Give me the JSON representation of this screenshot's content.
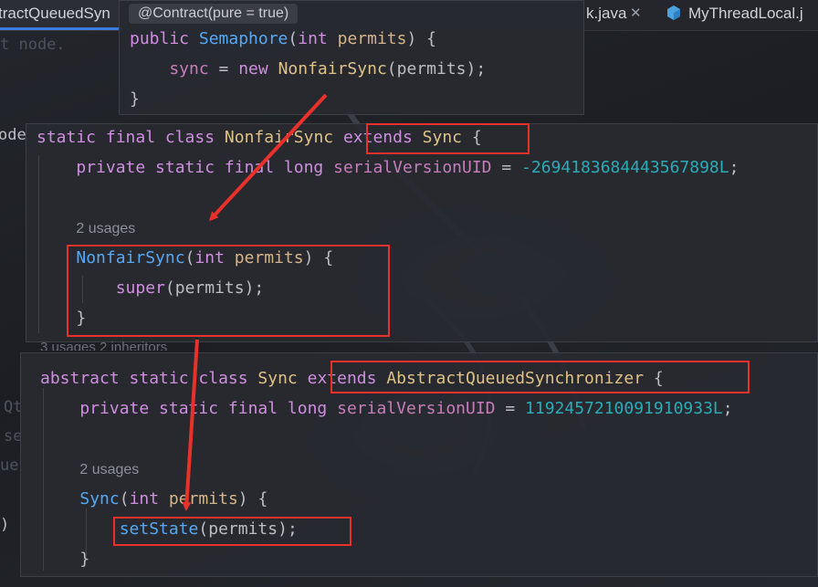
{
  "tabs": [
    {
      "label": "tractQueuedSyn",
      "active": true
    },
    {
      "label": "k.java",
      "active": false
    },
    {
      "label": "MyThreadLocal.j",
      "active": false
    }
  ],
  "background_fragments": {
    "comment": "t node.",
    "gutter_node": "ode",
    "left1": "Qt",
    "left2": "se",
    "left3": "ue",
    "left4": ")",
    "occluded": "3 usages   2 inheritors"
  },
  "popup": {
    "annotation": "@Contract(pure = true)",
    "lines": [
      [
        {
          "t": "public ",
          "c": "kw"
        },
        {
          "t": "Semaphore",
          "c": "fn"
        },
        {
          "t": "(",
          "c": ""
        },
        {
          "t": "int ",
          "c": "kw"
        },
        {
          "t": "permits",
          "c": "param"
        },
        {
          "t": ") {",
          "c": ""
        }
      ],
      [
        {
          "t": "    sync",
          "c": "field"
        },
        {
          "t": " = ",
          "c": ""
        },
        {
          "t": "new ",
          "c": "kw"
        },
        {
          "t": "NonfairSync",
          "c": "cls"
        },
        {
          "t": "(permits);",
          "c": ""
        }
      ],
      [
        {
          "t": "}",
          "c": ""
        }
      ]
    ]
  },
  "nonfair": {
    "lines": [
      [
        {
          "t": "static final class ",
          "c": "kw"
        },
        {
          "t": "NonfairSync ",
          "c": "cls"
        },
        {
          "t": "extends ",
          "c": "kw"
        },
        {
          "t": "Sync",
          "c": "cls"
        },
        {
          "t": " {",
          "c": ""
        }
      ],
      [
        {
          "t": "    private static final long ",
          "c": "kw"
        },
        {
          "t": "serialVersionUID",
          "c": "field"
        },
        {
          "t": " = ",
          "c": ""
        },
        {
          "t": "-2694183684443567898L",
          "c": "num"
        },
        {
          "t": ";",
          "c": ""
        }
      ],
      [
        {
          "t": "",
          "c": ""
        }
      ],
      [
        {
          "t": "    ",
          "c": ""
        },
        {
          "t": "2 usages",
          "c": "hint"
        }
      ],
      [
        {
          "t": "    ",
          "c": ""
        },
        {
          "t": "NonfairSync",
          "c": "fn"
        },
        {
          "t": "(",
          "c": ""
        },
        {
          "t": "int ",
          "c": "kw"
        },
        {
          "t": "permits",
          "c": "param"
        },
        {
          "t": ") {",
          "c": ""
        }
      ],
      [
        {
          "t": "        ",
          "c": ""
        },
        {
          "t": "super",
          "c": "kw"
        },
        {
          "t": "(permits);",
          "c": ""
        }
      ],
      [
        {
          "t": "    }",
          "c": ""
        }
      ]
    ]
  },
  "sync": {
    "lines": [
      [
        {
          "t": "abstract static class ",
          "c": "kw"
        },
        {
          "t": "Sync ",
          "c": "cls"
        },
        {
          "t": "extends ",
          "c": "kw"
        },
        {
          "t": "AbstractQueuedSynchronizer",
          "c": "cls"
        },
        {
          "t": " {",
          "c": ""
        }
      ],
      [
        {
          "t": "    private static final long ",
          "c": "kw"
        },
        {
          "t": "serialVersionUID",
          "c": "field"
        },
        {
          "t": " = ",
          "c": ""
        },
        {
          "t": "1192457210091910933L",
          "c": "num"
        },
        {
          "t": ";",
          "c": ""
        }
      ],
      [
        {
          "t": "",
          "c": ""
        }
      ],
      [
        {
          "t": "    ",
          "c": ""
        },
        {
          "t": "2 usages",
          "c": "hint"
        }
      ],
      [
        {
          "t": "    ",
          "c": ""
        },
        {
          "t": "Sync",
          "c": "fn"
        },
        {
          "t": "(",
          "c": ""
        },
        {
          "t": "int ",
          "c": "kw"
        },
        {
          "t": "permits",
          "c": "param"
        },
        {
          "t": ") {",
          "c": ""
        }
      ],
      [
        {
          "t": "        ",
          "c": ""
        },
        {
          "t": "setState",
          "c": "fn"
        },
        {
          "t": "(permits);",
          "c": ""
        }
      ],
      [
        {
          "t": "    }",
          "c": ""
        }
      ]
    ]
  },
  "colors": {
    "keyword": "#cf8ee0",
    "method": "#56a8f5",
    "class": "#e0c287",
    "number": "#2aacb8",
    "highlight_box": "#e8312b"
  }
}
